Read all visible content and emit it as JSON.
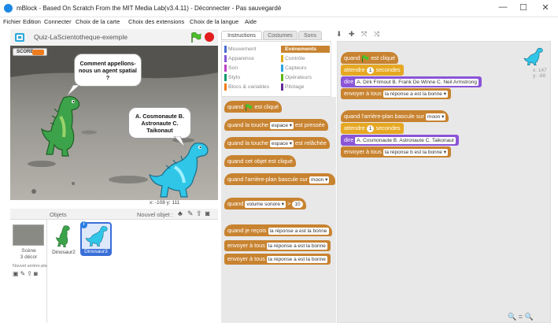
{
  "window": {
    "title": "mBlock - Based On Scratch From the MIT Media Lab(v3.4.11) - Déconnecter - Pas sauvegardé",
    "minimize": "—",
    "maximize": "☐",
    "close": "✕"
  },
  "menu": [
    "Fichier",
    "Edition",
    "Connecter",
    "Choix de la carte",
    "Choix des extensions",
    "Choix de la langue",
    "Aide"
  ],
  "stage": {
    "project_name": "Quiz-LaScientotheque-exemple",
    "score_label": "SCORE",
    "question": "Comment appellons-nous un agent spatial ?",
    "answer": "A. Cosmonaute B. Astronaute C. Taikonaut",
    "coords": "x: -108  y: 111"
  },
  "sprites": {
    "header": "Objets",
    "new_object": "Nouvel objet :",
    "scene_label": "Scène",
    "scene_sub": "3 décor",
    "new_backdrop": "Nouvel arrière-plan :",
    "items": [
      {
        "name": "Dinosaur2",
        "color": "#3da34a"
      },
      {
        "name": "Dinosaur3",
        "color": "#2fc6e8"
      }
    ],
    "info_badge": "i"
  },
  "tabs": [
    "Instructions",
    "Costumes",
    "Sons"
  ],
  "categories": {
    "left": [
      {
        "label": "Mouvement",
        "color": "#4a6cd4"
      },
      {
        "label": "Apparence",
        "color": "#8a55d7"
      },
      {
        "label": "Son",
        "color": "#bb42c3"
      },
      {
        "label": "Stylo",
        "color": "#0e9a6c"
      },
      {
        "label": "Blocs & variables",
        "color": "#ee7d16"
      }
    ],
    "right": [
      {
        "label": "Evénements",
        "color": "#c88330"
      },
      {
        "label": "Contrôle",
        "color": "#e1a91a"
      },
      {
        "label": "Capteurs",
        "color": "#2ca5e2"
      },
      {
        "label": "Opérateurs",
        "color": "#5cb712"
      },
      {
        "label": "Pilotage",
        "color": "#632d99"
      }
    ]
  },
  "palette": {
    "when_flag": "quand",
    "when_flag_tail": "est cliqué",
    "key_pressed_a": "quand la touche",
    "key_pressed_key": "espace ▾",
    "key_pressed_b": "est pressée",
    "key_released_a": "quand la touche",
    "key_released_key": "espace ▾",
    "key_released_b": "est relâchée",
    "sprite_clicked": "quand cet objet est cliqué",
    "backdrop_switch_a": "quand l'arrière-plan bascule sur",
    "backdrop_switch_val": "moon ▾",
    "sensor_a": "quand",
    "sensor_val": "volume sonore ▾",
    "sensor_op": ">",
    "sensor_num": "10",
    "receive_a": "quand je reçois",
    "receive_val": "la réponse a est la bonne",
    "broadcast_a": "envoyer à tous",
    "broadcast_val": "la réponse a est la bonne",
    "broadcast_wait_a": "envoyer à tous",
    "broadcast_wait_val": "la réponse a est la bonne"
  },
  "script1": {
    "hat_a": "quand",
    "hat_b": "est cliqué",
    "wait_a": "attendre",
    "wait_num": "1",
    "wait_b": "secondes",
    "say_a": "dire",
    "say_val": "A. Dirk Frimout B. Frank De Winne C. Neil Armstrong",
    "send_a": "envoyer à tous",
    "send_val": "la réponse a est la bonne ▾"
  },
  "script2": {
    "hat_a": "quand l'arrière-plan bascule sur",
    "hat_val": "moon ▾",
    "wait_a": "attendre",
    "wait_num": "1",
    "wait_b": "secondes",
    "say_a": "dire",
    "say_val": "A. Cosmonaute B. Astronaute C. Taikonaut",
    "send_a": "envoyer à tous",
    "send_val": "la réponse b est la bonne ▾"
  },
  "script_area": {
    "sprite_x": "x: 147",
    "sprite_y": "y: -68",
    "zoom": "🔍 = 🔍"
  },
  "toolbar_icons": "⬇ ✚ ⤧ ⤨"
}
